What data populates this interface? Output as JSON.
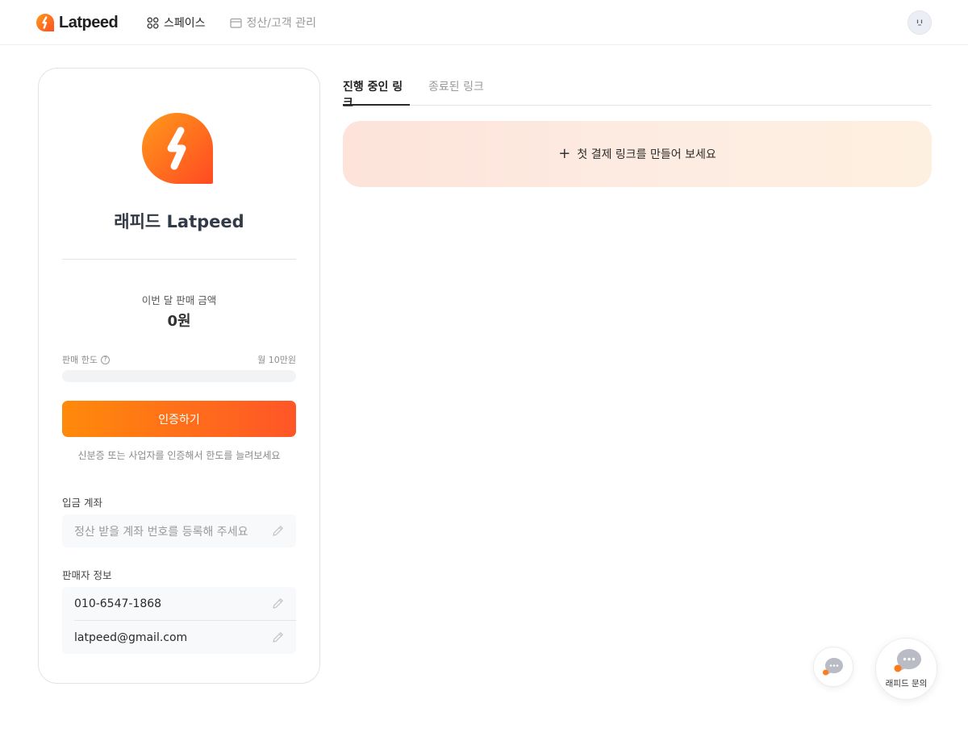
{
  "header": {
    "brand": "Latpeed",
    "nav": [
      {
        "label": "스페이스",
        "icon": "grid-icon",
        "active": true
      },
      {
        "label": "정산/고객 관리",
        "icon": "wallet-icon",
        "active": false
      }
    ],
    "avatar_icon": "robot-face-icon"
  },
  "space": {
    "name": "래피드 Latpeed",
    "logo_icon": "latpeed-bolt-logo",
    "sales_label": "이번 달 판매 금액",
    "sales_value": "0원",
    "limit_label": "판매 한도",
    "limit_help": "?",
    "limit_value": "월 10만원",
    "limit_progress": 0,
    "verify_button": "인증하기",
    "verify_hint": "신분증 또는 사업자를 인증해서 한도를 늘려보세요",
    "account_label": "입금 계좌",
    "account_placeholder": "정산 받을 계좌 번호를 등록해 주세요",
    "seller_label": "판매자 정보",
    "seller_phone": "010-6547-1868",
    "seller_email": "latpeed@gmail.com"
  },
  "tabs": [
    {
      "label": "진행 중인 링크",
      "active": true
    },
    {
      "label": "종료된 링크",
      "active": false
    }
  ],
  "create_banner": {
    "icon": "plus-icon",
    "plus": "+",
    "text": "첫 결제 링크를 만들어 보세요"
  },
  "chat": {
    "small_icon": "chat-bubble-icon",
    "large_icon": "chat-bubble-icon",
    "large_label": "래피드 문의"
  },
  "colors": {
    "brand_orange": "#ff7a1a",
    "brand_red_orange": "#ff5627",
    "text_dark": "#222222",
    "text_muted": "#9a9a9a"
  }
}
